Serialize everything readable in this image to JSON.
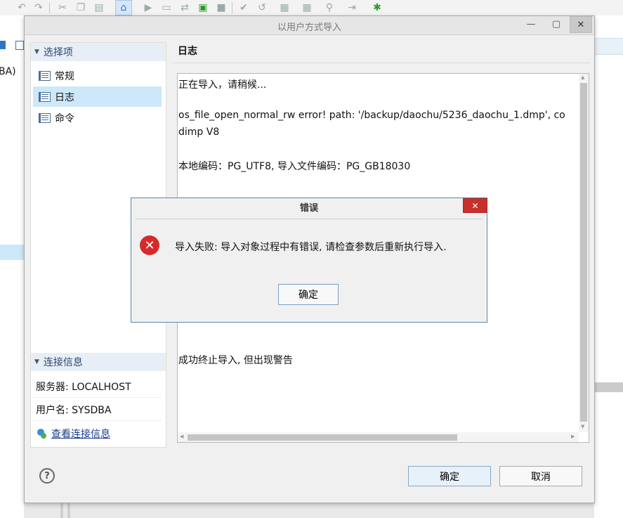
{
  "dialog": {
    "title": "以用户方式导入",
    "ok_label": "确定",
    "cancel_label": "取消"
  },
  "sidebar": {
    "options_header": "选择项",
    "items": [
      {
        "label": "常规"
      },
      {
        "label": "日志"
      },
      {
        "label": "命令"
      }
    ],
    "connection_header": "连接信息",
    "server": "服务器: LOCALHOST",
    "user": "用户名: SYSDBA",
    "view_link": "查看连接信息"
  },
  "log": {
    "title": "日志",
    "lines": [
      "正在导入，请稍候...",
      "os_file_open_normal_rw error! path: '/backup/daochu/5236_daochu_1.dmp', co",
      "dimp V8",
      "本地编码：PG_UTF8, 导入文件编码：PG_GB18030",
      "成功终止导入, 但出现警告"
    ]
  },
  "error_dialog": {
    "title": "错误",
    "message": "导入失败: 导入对象过程中有错误, 请检查参数后重新执行导入.",
    "ok_label": "确定"
  },
  "background": {
    "left_fragment": "BA)"
  },
  "colors": {
    "accent": "#2f74c7",
    "selection": "#cde8f8",
    "error": "#d52b2b"
  }
}
